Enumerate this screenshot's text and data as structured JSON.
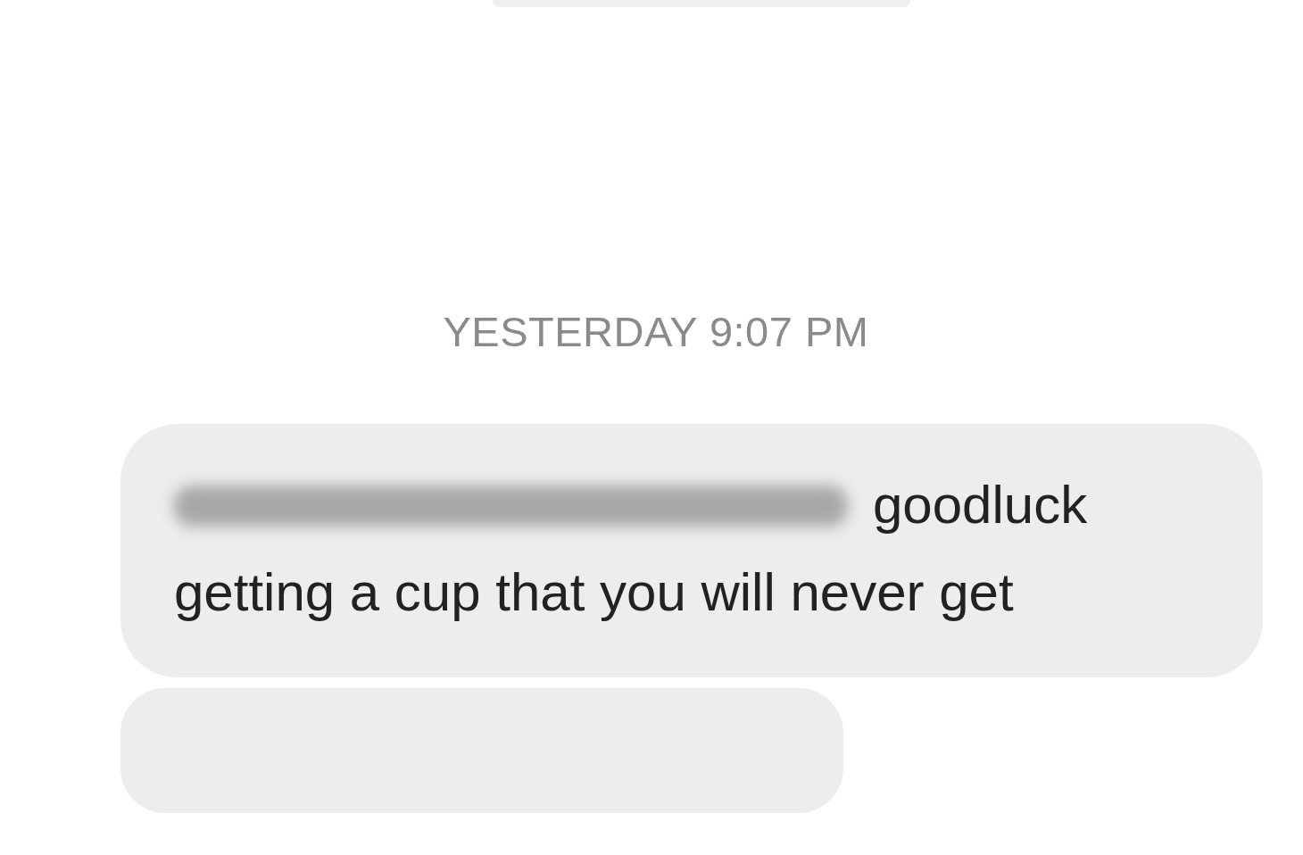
{
  "timestamp": "YESTERDAY 9:07 PM",
  "messages": [
    {
      "redacted": true,
      "text": "goodluck getting a cup that you will never get"
    }
  ]
}
